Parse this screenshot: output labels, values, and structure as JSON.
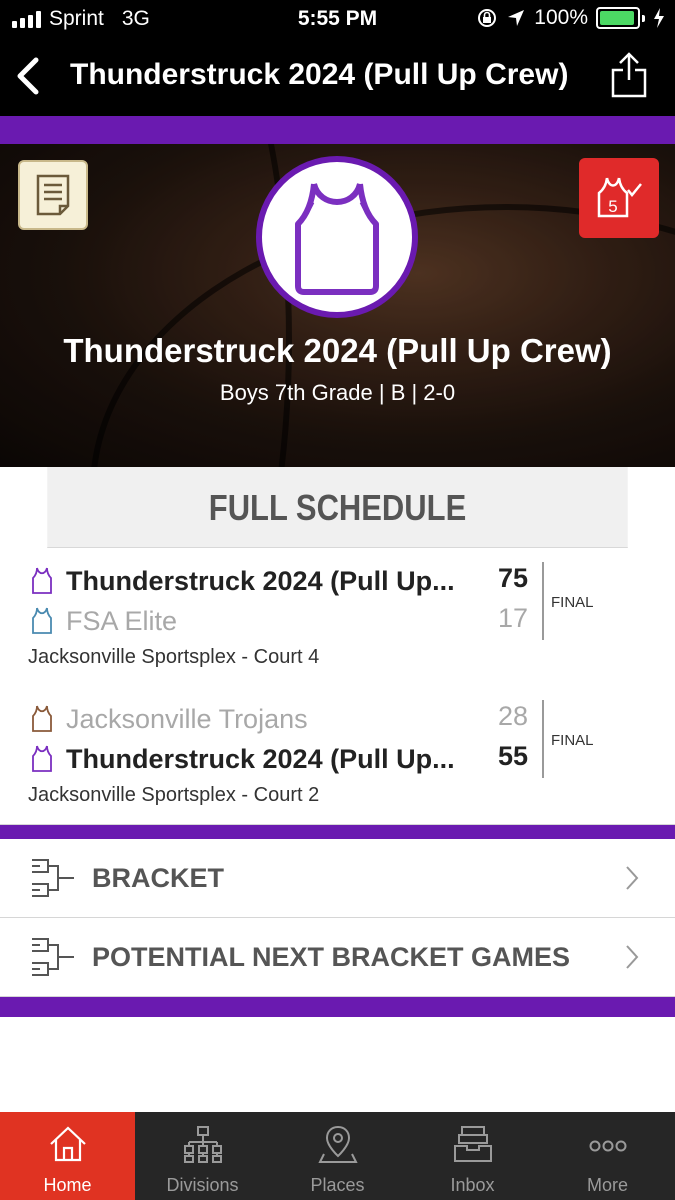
{
  "status_bar": {
    "carrier": "Sprint",
    "network": "3G",
    "time": "5:55 PM",
    "battery": "100%",
    "battery_color": "#4cd964"
  },
  "nav": {
    "title": "Thunderstruck 2024 (Pull Up Crew)",
    "back_icon": "chevron-left-icon",
    "share_icon": "share-icon"
  },
  "hero": {
    "team_name": "Thunderstruck 2024 (Pull Up Crew)",
    "meta": "Boys 7th Grade | B | 2-0",
    "vote_badge": "5",
    "accent": "#6a1ab0",
    "vote_color": "#e02a2a"
  },
  "schedule": {
    "header": "FULL SCHEDULE",
    "games": [
      {
        "team1": {
          "name": "Thunderstruck 2024 (Pull Up...",
          "score": "75",
          "jersey_color": "#7b2fc0",
          "winner": true
        },
        "team2": {
          "name": "FSA Elite",
          "score": "17",
          "jersey_color": "#4a8ab0",
          "winner": false
        },
        "status": "FINAL",
        "venue": "Jacksonville Sportsplex - Court 4"
      },
      {
        "team1": {
          "name": "Jacksonville Trojans",
          "score": "28",
          "jersey_color": "#8a5a3a",
          "winner": false
        },
        "team2": {
          "name": "Thunderstruck 2024 (Pull Up...",
          "score": "55",
          "jersey_color": "#7b2fc0",
          "winner": true
        },
        "status": "FINAL",
        "venue": "Jacksonville Sportsplex - Court 2"
      }
    ]
  },
  "menu": [
    {
      "label": "BRACKET",
      "icon": "bracket-icon"
    },
    {
      "label": "POTENTIAL NEXT BRACKET GAMES",
      "icon": "bracket-icon"
    }
  ],
  "tabs": [
    {
      "label": "Home",
      "icon": "home-icon",
      "active": true
    },
    {
      "label": "Divisions",
      "icon": "divisions-icon",
      "active": false
    },
    {
      "label": "Places",
      "icon": "places-icon",
      "active": false
    },
    {
      "label": "Inbox",
      "icon": "inbox-icon",
      "active": false
    },
    {
      "label": "More",
      "icon": "more-icon",
      "active": false
    }
  ]
}
